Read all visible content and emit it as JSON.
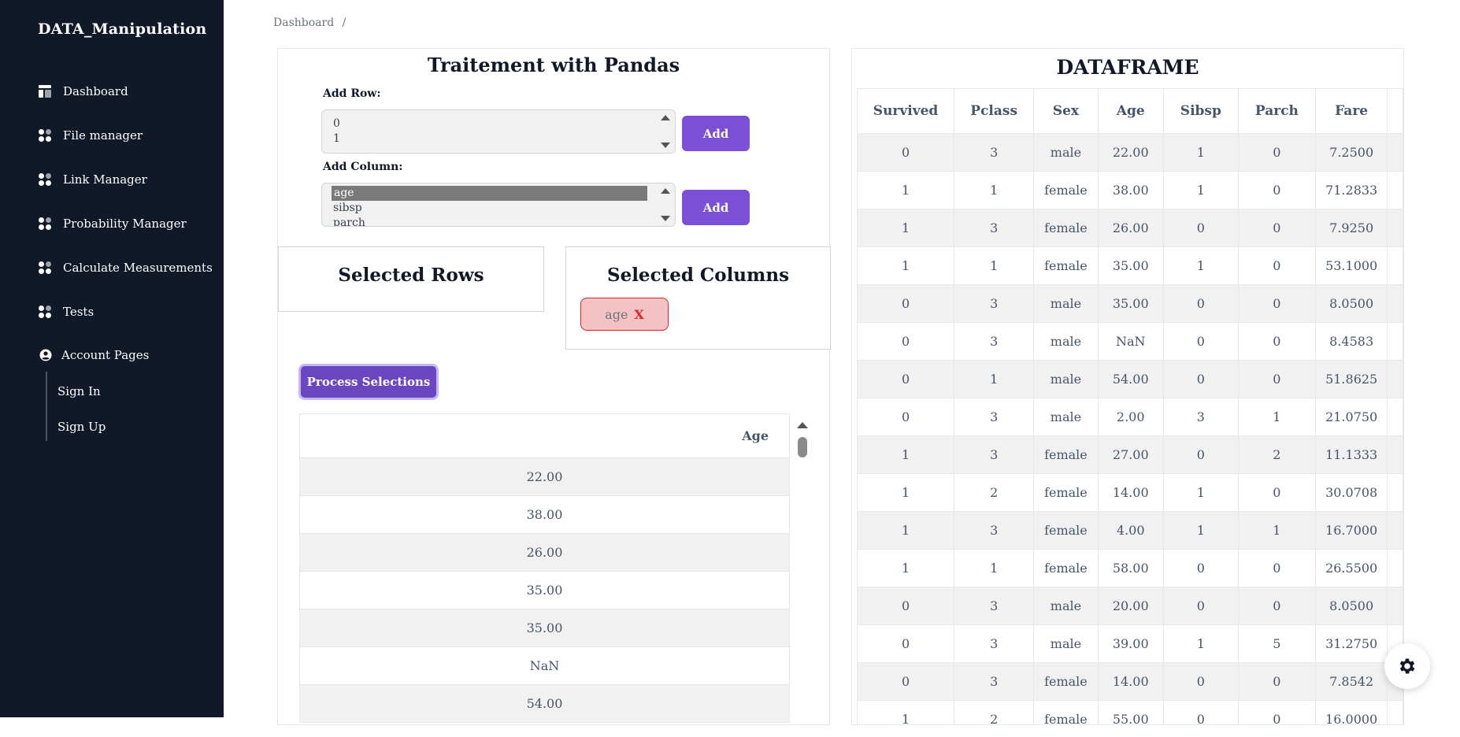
{
  "app": {
    "brand": "DATA_Manipulation"
  },
  "sidebar": {
    "items": [
      {
        "label": "Dashboard",
        "icon": "dashboard-icon"
      },
      {
        "label": "File manager",
        "icon": "grid-icon"
      },
      {
        "label": "Link Manager",
        "icon": "grid-icon"
      },
      {
        "label": "Probability Manager",
        "icon": "grid-icon"
      },
      {
        "label": "Calculate Measurements",
        "icon": "grid-icon"
      },
      {
        "label": "Tests",
        "icon": "grid-icon"
      }
    ],
    "account": {
      "label": "Account Pages",
      "icon": "user-circle-icon",
      "children": [
        {
          "label": "Sign In"
        },
        {
          "label": "Sign Up"
        }
      ]
    }
  },
  "breadcrumb": {
    "root": "Dashboard",
    "separator": "/"
  },
  "left_panel": {
    "title": "Traitement with Pandas",
    "add_row": {
      "label": "Add Row:",
      "options": [
        "0",
        "1"
      ],
      "button": "Add"
    },
    "add_column": {
      "label": "Add Column:",
      "options": [
        "age",
        "sibsp",
        "parch"
      ],
      "selected": "age",
      "button": "Add"
    },
    "selected_rows": {
      "title": "Selected Rows"
    },
    "selected_columns": {
      "title": "Selected Columns",
      "chips": [
        {
          "label": "age",
          "remove": "X"
        }
      ]
    },
    "process_button": "Process Selections",
    "result_table": {
      "header": "Age",
      "values": [
        "22.00",
        "38.00",
        "26.00",
        "35.00",
        "35.00",
        "NaN",
        "54.00"
      ]
    }
  },
  "right_panel": {
    "title": "DATAFRAME",
    "columns": [
      "Survived",
      "Pclass",
      "Sex",
      "Age",
      "Sibsp",
      "Parch",
      "Fare"
    ],
    "rows": [
      [
        "0",
        "3",
        "male",
        "22.00",
        "1",
        "0",
        "7.2500"
      ],
      [
        "1",
        "1",
        "female",
        "38.00",
        "1",
        "0",
        "71.2833"
      ],
      [
        "1",
        "3",
        "female",
        "26.00",
        "0",
        "0",
        "7.9250"
      ],
      [
        "1",
        "1",
        "female",
        "35.00",
        "1",
        "0",
        "53.1000"
      ],
      [
        "0",
        "3",
        "male",
        "35.00",
        "0",
        "0",
        "8.0500"
      ],
      [
        "0",
        "3",
        "male",
        "NaN",
        "0",
        "0",
        "8.4583"
      ],
      [
        "0",
        "1",
        "male",
        "54.00",
        "0",
        "0",
        "51.8625"
      ],
      [
        "0",
        "3",
        "male",
        "2.00",
        "3",
        "1",
        "21.0750"
      ],
      [
        "1",
        "3",
        "female",
        "27.00",
        "0",
        "2",
        "11.1333"
      ],
      [
        "1",
        "2",
        "female",
        "14.00",
        "1",
        "0",
        "30.0708"
      ],
      [
        "1",
        "3",
        "female",
        "4.00",
        "1",
        "1",
        "16.7000"
      ],
      [
        "1",
        "1",
        "female",
        "58.00",
        "0",
        "0",
        "26.5500"
      ],
      [
        "0",
        "3",
        "male",
        "20.00",
        "0",
        "0",
        "8.0500"
      ],
      [
        "0",
        "3",
        "male",
        "39.00",
        "1",
        "5",
        "31.2750"
      ],
      [
        "0",
        "3",
        "female",
        "14.00",
        "0",
        "0",
        "7.8542"
      ],
      [
        "1",
        "2",
        "female",
        "55.00",
        "0",
        "0",
        "16.0000"
      ]
    ]
  },
  "floating": {
    "icon": "gear-icon"
  }
}
